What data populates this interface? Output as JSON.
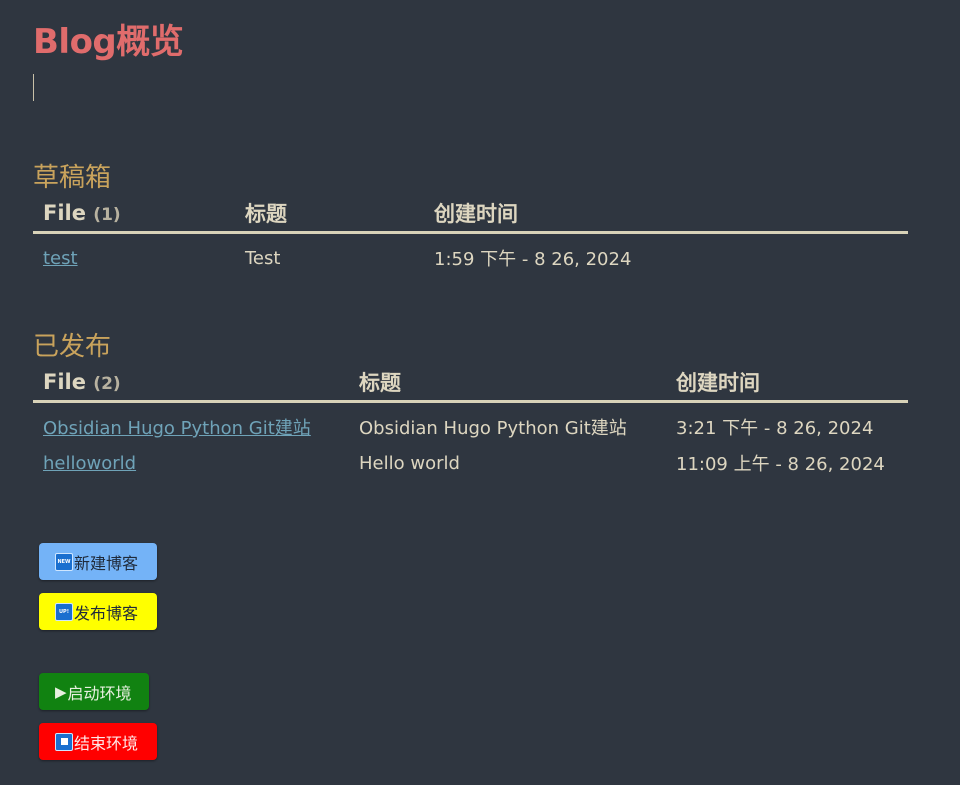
{
  "page": {
    "title": "Blog概览"
  },
  "drafts": {
    "heading": "草稿箱",
    "columns": {
      "file": "File",
      "file_count": "(1)",
      "title": "标题",
      "created": "创建时间"
    },
    "rows": [
      {
        "file": "test",
        "title": "Test",
        "created": "1:59 下午 - 8 26, 2024"
      }
    ]
  },
  "published": {
    "heading": "已发布",
    "columns": {
      "file": "File",
      "file_count": "(2)",
      "title": "标题",
      "created": "创建时间"
    },
    "rows": [
      {
        "file": "Obsidian Hugo Python Git建站",
        "title": "Obsidian Hugo Python Git建站",
        "created": "3:21 下午 - 8 26, 2024"
      },
      {
        "file": "helloworld",
        "title": "Hello world",
        "created": "11:09 上午 - 8 26, 2024"
      }
    ]
  },
  "buttons": {
    "new_blog": {
      "label": "新建博客",
      "icon": "new-icon",
      "icon_text": "NEW",
      "color": "#74b3f7"
    },
    "publish_blog": {
      "label": "发布博客",
      "icon": "up-icon",
      "icon_text": "UP!",
      "color": "#ffff00"
    },
    "start_env": {
      "label": "启动环境",
      "icon": "play-icon",
      "icon_text": "▶",
      "color": "#118211"
    },
    "stop_env": {
      "label": "结束环境",
      "icon": "stop-icon",
      "color": "#ff0000"
    }
  }
}
